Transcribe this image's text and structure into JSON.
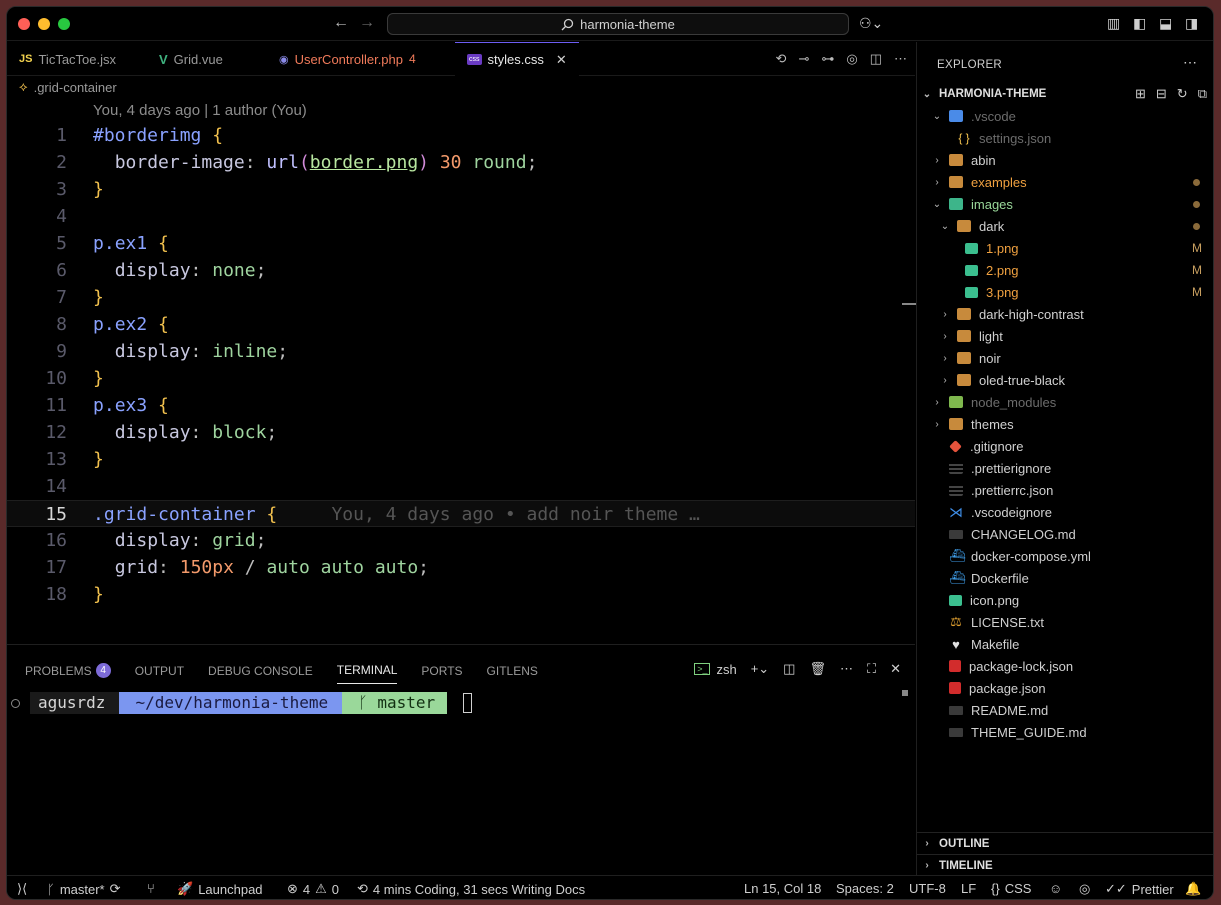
{
  "titlebar": {
    "search_text": "harmonia-theme",
    "back_arrow": "←",
    "forward_arrow": "→"
  },
  "tabs": [
    {
      "icon": "JS",
      "label": "TicTacToe.jsx",
      "icon_color": "#f2d24e"
    },
    {
      "icon": "V",
      "label": "Grid.vue",
      "icon_color": "#3fb27f"
    },
    {
      "icon": "◉",
      "label": "UserController.php",
      "badge": "4",
      "label_color": "#f07a5a",
      "icon_color": "#8a8ae8"
    },
    {
      "icon": "css",
      "label": "styles.css",
      "active": true,
      "close": "✕"
    }
  ],
  "breadcrumb": {
    "label": ".grid-container"
  },
  "codelens": "You, 4 days ago | 1 author (You)",
  "code_lines": [
    {
      "n": "1"
    },
    {
      "n": "2"
    },
    {
      "n": "3"
    },
    {
      "n": "4"
    },
    {
      "n": "5"
    },
    {
      "n": "6"
    },
    {
      "n": "7"
    },
    {
      "n": "8"
    },
    {
      "n": "9"
    },
    {
      "n": "10"
    },
    {
      "n": "11"
    },
    {
      "n": "12"
    },
    {
      "n": "13"
    },
    {
      "n": "14"
    },
    {
      "n": "15"
    },
    {
      "n": "16"
    },
    {
      "n": "17"
    },
    {
      "n": "18"
    }
  ],
  "code": {
    "l1_sel": "#borderimg",
    "l2_prop": "border-image",
    "l2_fn": "url",
    "l2_url": "border.png",
    "l2_num": "30",
    "l2_val": "round",
    "l5_sel": "ex1",
    "l6_prop": "display",
    "l6_val": "none",
    "l8_sel": "ex2",
    "l9_prop": "display",
    "l9_val": "inline",
    "l11_sel": "ex3",
    "l12_prop": "display",
    "l12_val": "block",
    "l15_sel": "grid-container",
    "l15_blame": "You, 4 days ago • add noir theme …",
    "l16_prop": "display",
    "l16_val": "grid",
    "l17_prop": "grid",
    "l17_num": "150px",
    "l17_val": "auto auto auto"
  },
  "panel": {
    "tabs": [
      {
        "label": "PROBLEMS",
        "badge": "4"
      },
      {
        "label": "OUTPUT"
      },
      {
        "label": "DEBUG CONSOLE"
      },
      {
        "label": "TERMINAL",
        "active": true
      },
      {
        "label": "PORTS"
      },
      {
        "label": "GITLENS"
      }
    ],
    "shell": "zsh"
  },
  "terminal": {
    "user": "agusrdz",
    "path": "~/dev/harmonia-theme",
    "branch": "master"
  },
  "explorer": {
    "title": "EXPLORER",
    "root": "HARMONIA-THEME",
    "items": [
      {
        "label": ".vscode",
        "depth": 1,
        "chev": "⌄",
        "icon": "folder-blue",
        "dim": true
      },
      {
        "label": "settings.json",
        "depth": 2,
        "icon": "json",
        "dim": true
      },
      {
        "label": "abin",
        "depth": 1,
        "chev": "›",
        "icon": "folder"
      },
      {
        "label": "examples",
        "depth": 1,
        "chev": "›",
        "icon": "folder",
        "color": "orange",
        "dot": true
      },
      {
        "label": "images",
        "depth": 1,
        "chev": "⌄",
        "icon": "folder-green",
        "color": "green",
        "dot": true
      },
      {
        "label": "dark",
        "depth": 2,
        "chev": "⌄",
        "icon": "folder",
        "dot": true
      },
      {
        "label": "1.png",
        "depth": 3,
        "icon": "img",
        "color": "orange",
        "git": "M"
      },
      {
        "label": "2.png",
        "depth": 3,
        "icon": "img",
        "color": "orange",
        "git": "M"
      },
      {
        "label": "3.png",
        "depth": 3,
        "icon": "img",
        "color": "orange",
        "git": "M"
      },
      {
        "label": "dark-high-contrast",
        "depth": 2,
        "chev": "›",
        "icon": "folder"
      },
      {
        "label": "light",
        "depth": 2,
        "chev": "›",
        "icon": "folder"
      },
      {
        "label": "noir",
        "depth": 2,
        "chev": "›",
        "icon": "folder"
      },
      {
        "label": "oled-true-black",
        "depth": 2,
        "chev": "›",
        "icon": "folder"
      },
      {
        "label": "node_modules",
        "depth": 1,
        "chev": "›",
        "icon": "folder-node",
        "dim": true
      },
      {
        "label": "themes",
        "depth": 1,
        "chev": "›",
        "icon": "folder"
      },
      {
        "label": ".gitignore",
        "depth": 1,
        "icon": "git"
      },
      {
        "label": ".prettierignore",
        "depth": 1,
        "icon": "prettier"
      },
      {
        "label": ".prettierrc.json",
        "depth": 1,
        "icon": "prettier"
      },
      {
        "label": ".vscodeignore",
        "depth": 1,
        "icon": "vscode"
      },
      {
        "label": "CHANGELOG.md",
        "depth": 1,
        "icon": "md"
      },
      {
        "label": "docker-compose.yml",
        "depth": 1,
        "icon": "docker"
      },
      {
        "label": "Dockerfile",
        "depth": 1,
        "icon": "docker"
      },
      {
        "label": "icon.png",
        "depth": 1,
        "icon": "img"
      },
      {
        "label": "LICENSE.txt",
        "depth": 1,
        "icon": "license"
      },
      {
        "label": "Makefile",
        "depth": 1,
        "icon": "make"
      },
      {
        "label": "package-lock.json",
        "depth": 1,
        "icon": "npm"
      },
      {
        "label": "package.json",
        "depth": 1,
        "icon": "npm"
      },
      {
        "label": "README.md",
        "depth": 1,
        "icon": "md"
      },
      {
        "label": "THEME_GUIDE.md",
        "depth": 1,
        "icon": "md"
      }
    ],
    "outline": "OUTLINE",
    "timeline": "TIMELINE"
  },
  "statusbar": {
    "branch": "master*",
    "launchpad": "Launchpad",
    "errors": "4",
    "warnings": "0",
    "coding": "4 mins Coding, 31 secs Writing Docs",
    "position": "Ln 15, Col 18",
    "spaces": "Spaces: 2",
    "encoding": "UTF-8",
    "eol": "LF",
    "language": "CSS",
    "prettier": "Prettier"
  }
}
